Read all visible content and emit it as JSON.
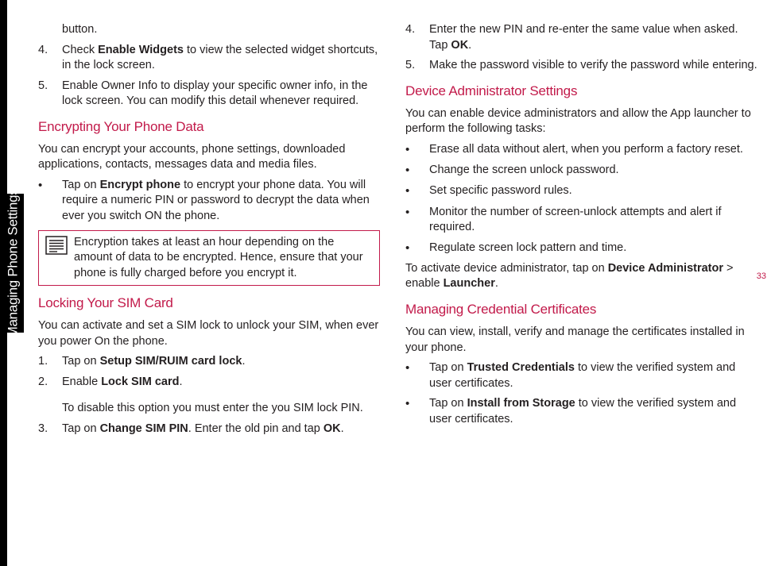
{
  "sidebar": {
    "label": "Managing Phone Settings"
  },
  "pageNumber": "33",
  "col1": {
    "cont_button": "button.",
    "item4_num": "4.",
    "item4_a": "Check ",
    "item4_b": "Enable Widgets",
    "item4_c": " to view the selected widget shortcuts, in the lock screen.",
    "item5_num": "5.",
    "item5": "Enable Owner Info to display your specific owner info, in the lock screen. You can modify this detail whenever required.",
    "h_encrypt": "Encrypting Your Phone Data",
    "p_encrypt": "You can encrypt your accounts, phone settings, downloaded applications, contacts, messages data and media files.",
    "b1_a": "Tap on ",
    "b1_b": "Encrypt phone",
    "b1_c": " to encrypt your phone data. You will require a numeric PIN or password to decrypt the data when ever you switch ON the phone.",
    "note": "Encryption takes at least an hour depending on the amount of data to be encrypted. Hence, ensure that your phone is fully charged before you encrypt it.",
    "h_sim": "Locking Your SIM Card",
    "p_sim": "You can activate and set a SIM lock to unlock your SIM, when ever you power On the phone.",
    "s1_num": "1.",
    "s1_a": "Tap on ",
    "s1_b": "Setup SIM/RUIM card lock",
    "s1_c": ".",
    "s2_num": "2.",
    "s2_a": "Enable ",
    "s2_b": "Lock SIM card",
    "s2_c": ".",
    "s2_p": "To disable this option you must enter the you SIM lock PIN.",
    "s3_num": "3.",
    "s3_a": "Tap on ",
    "s3_b": "Change SIM PIN",
    "s3_c": ". Enter the old pin and tap ",
    "s3_d": "OK",
    "s3_e": "."
  },
  "col2": {
    "s4_num": "4.",
    "s4_a": "Enter the new PIN and re-enter the same value when asked. Tap ",
    "s4_b": "OK",
    "s4_c": ".",
    "s5_num": "5.",
    "s5": "Make the password visible to verify the password while entering.",
    "h_admin": "Device Administrator Settings",
    "p_admin": "You can enable device administrators and allow the App launcher to perform the following tasks:",
    "ab1": "Erase all data without alert, when you perform a factory reset.",
    "ab2": "Change the screen unlock password.",
    "ab3": "Set specific password rules.",
    "ab4": "Monitor the number of screen-unlock attempts and alert if required.",
    "ab5": "Regulate screen lock pattern and time.",
    "p_admin2_a": "To activate device administrator, tap on ",
    "p_admin2_b": "Device Administrator",
    "p_admin2_c": " > enable ",
    "p_admin2_d": "Launcher",
    "p_admin2_e": ".",
    "h_cert": "Managing Credential Certificates",
    "p_cert": "You can view, install, verify and manage the certificates installed in your phone.",
    "cb1_a": "Tap on ",
    "cb1_b": "Trusted Credentials",
    "cb1_c": " to view the verified system and user certificates.",
    "cb2_a": "Tap on ",
    "cb2_b": "Install from Storage",
    "cb2_c": " to view the verified system and user certificates."
  }
}
